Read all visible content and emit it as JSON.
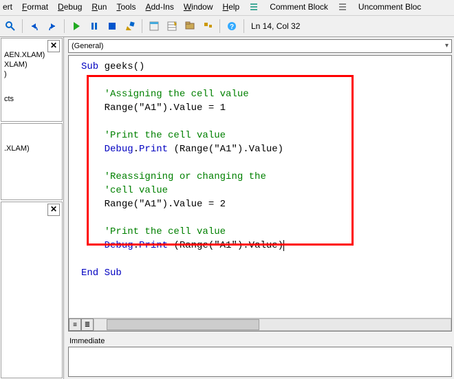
{
  "menu": {
    "insert": "ert",
    "format": "Format",
    "debug": "Debug",
    "run": "Run",
    "tools": "Tools",
    "addins": "Add-Ins",
    "window": "Window",
    "help": "Help",
    "comment": "Comment Block",
    "uncomment": "Uncomment Bloc"
  },
  "toolbar": {
    "status": "Ln 14, Col 32"
  },
  "dropdown": {
    "value": "(General)"
  },
  "left": {
    "item1": "AEN.XLAM)",
    "item2": "XLAM)",
    "item3": ")",
    "item4": "cts",
    "item5": ".XLAM)"
  },
  "code": {
    "l1a": "Sub",
    "l1b": " geeks()",
    "l2": "'Assigning the cell value",
    "l3": "Range(\"A1\").Value = 1",
    "l4": "'Print the cell value",
    "l5a": "Debug",
    "l5b": ".",
    "l5c": "Print",
    "l5d": " (Range(\"A1\").Value)",
    "l6": "'Reassigning or changing the",
    "l7": "'cell value",
    "l8": "Range(\"A1\").Value = 2",
    "l9": "'Print the cell value",
    "l10a": "Debug",
    "l10b": ".",
    "l10c": "Print",
    "l10d": " (Range(\"A1\").Value)",
    "l11": "End Sub"
  },
  "immediate": {
    "label": "Immediate"
  }
}
